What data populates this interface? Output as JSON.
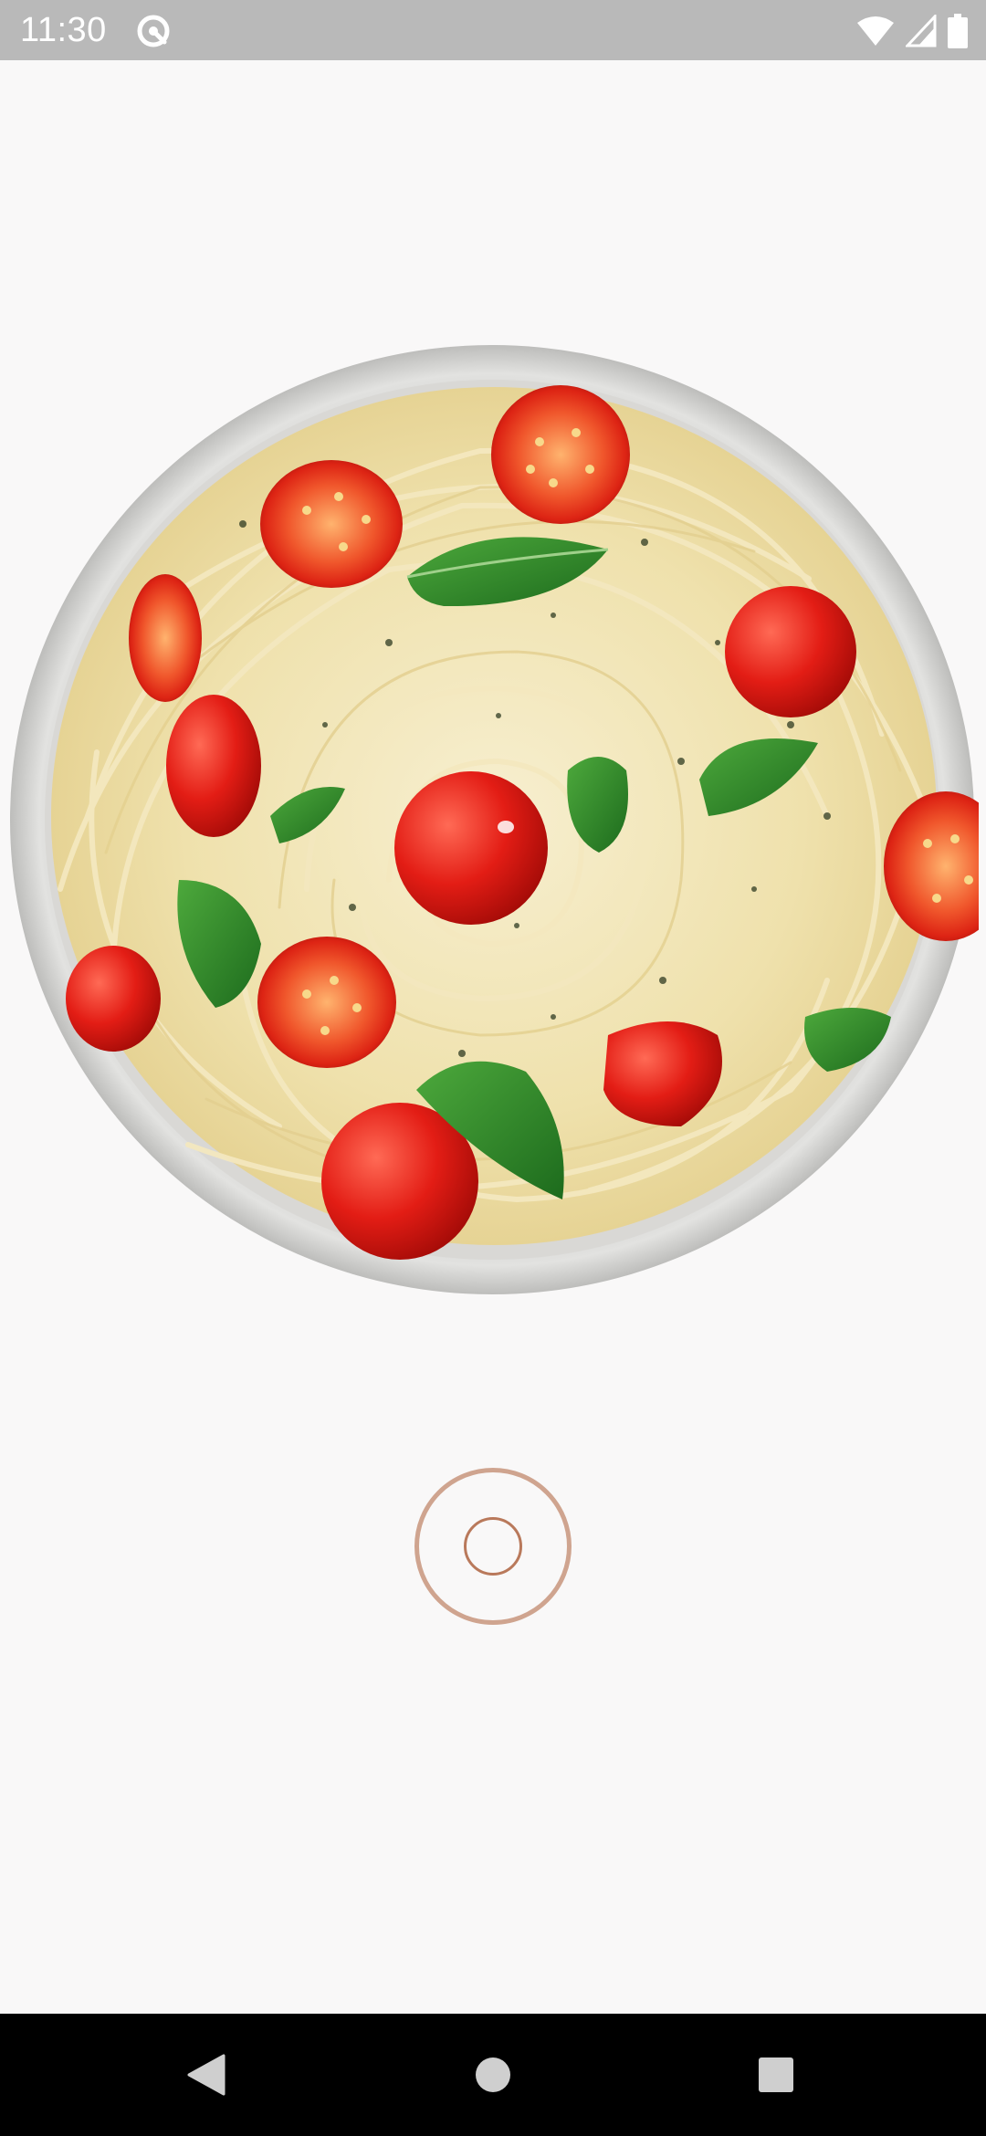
{
  "status_bar": {
    "time": "11:30",
    "left_icon": "data-saver-icon",
    "right_icons": [
      "wifi-icon",
      "cellular-signal-icon",
      "battery-icon"
    ]
  },
  "main": {
    "image": "spaghetti-with-cherry-tomatoes-and-basil",
    "shutter_button": "capture-icon"
  },
  "navigation_bar": {
    "buttons": [
      "back-icon",
      "home-icon",
      "recents-icon"
    ]
  },
  "colors": {
    "status_bar_bg": "#b9b9b9",
    "background": "#f9f8f8",
    "shutter_ring": "#cfa48f",
    "shutter_inner": "#b9795b",
    "nav_bar_bg": "#000000"
  }
}
